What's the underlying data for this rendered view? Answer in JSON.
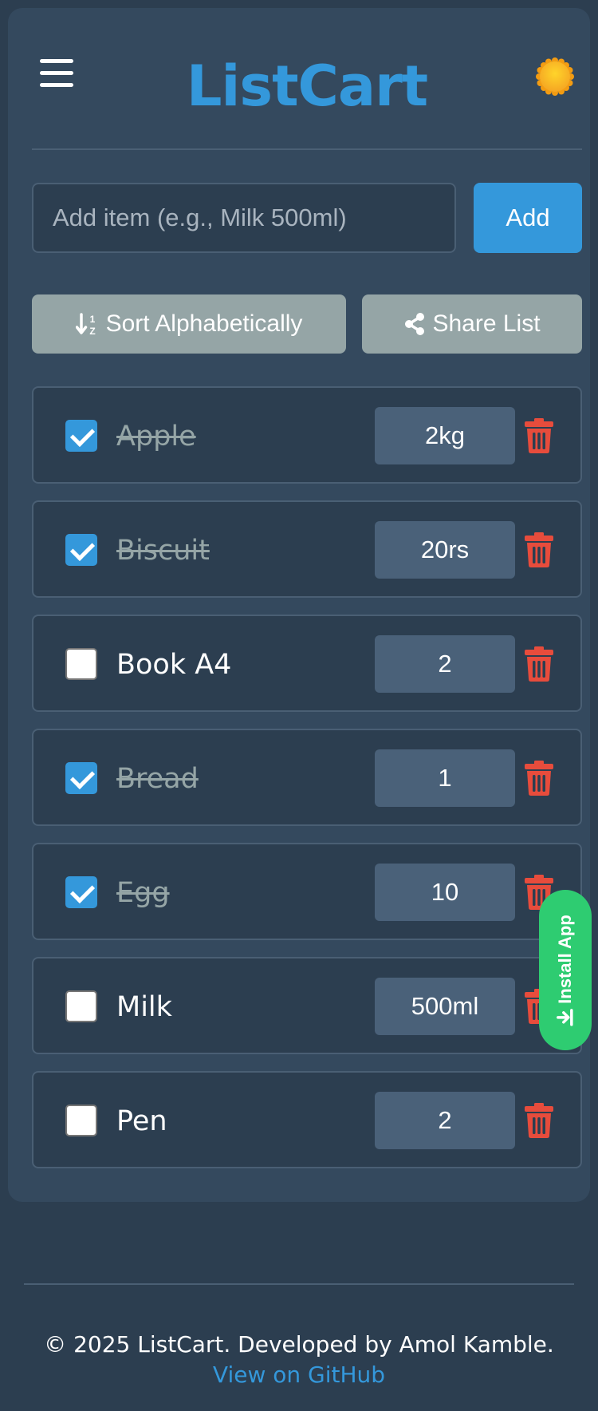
{
  "app": {
    "title": "ListCart"
  },
  "icons": {
    "menu": "hamburger-menu-icon",
    "theme": "sun-icon",
    "sort": "sort-alpha-icon",
    "share": "share-icon",
    "delete": "trash-icon",
    "install": "download-icon"
  },
  "colors": {
    "accent": "#3498db",
    "danger": "#e74c3c",
    "install": "#2ecc71",
    "background": "#2c3e50",
    "card": "#34495e"
  },
  "add_form": {
    "placeholder": "Add item (e.g., Milk 500ml)",
    "value": "",
    "button_label": "Add"
  },
  "actions": {
    "sort_label": "Sort Alphabetically",
    "share_label": "Share List"
  },
  "items": [
    {
      "name": "Apple",
      "qty": "2kg",
      "checked": true
    },
    {
      "name": "Biscuit",
      "qty": "20rs",
      "checked": true
    },
    {
      "name": "Book A4",
      "qty": "2",
      "checked": false
    },
    {
      "name": "Bread",
      "qty": "1",
      "checked": true
    },
    {
      "name": "Egg",
      "qty": "10",
      "checked": true
    },
    {
      "name": "Milk",
      "qty": "500ml",
      "checked": false
    },
    {
      "name": "Pen",
      "qty": "2",
      "checked": false
    }
  ],
  "install": {
    "label": "Install App"
  },
  "footer": {
    "copyright": "© 2025 ListCart. Developed by Amol Kamble.",
    "link_label": "View on GitHub"
  }
}
